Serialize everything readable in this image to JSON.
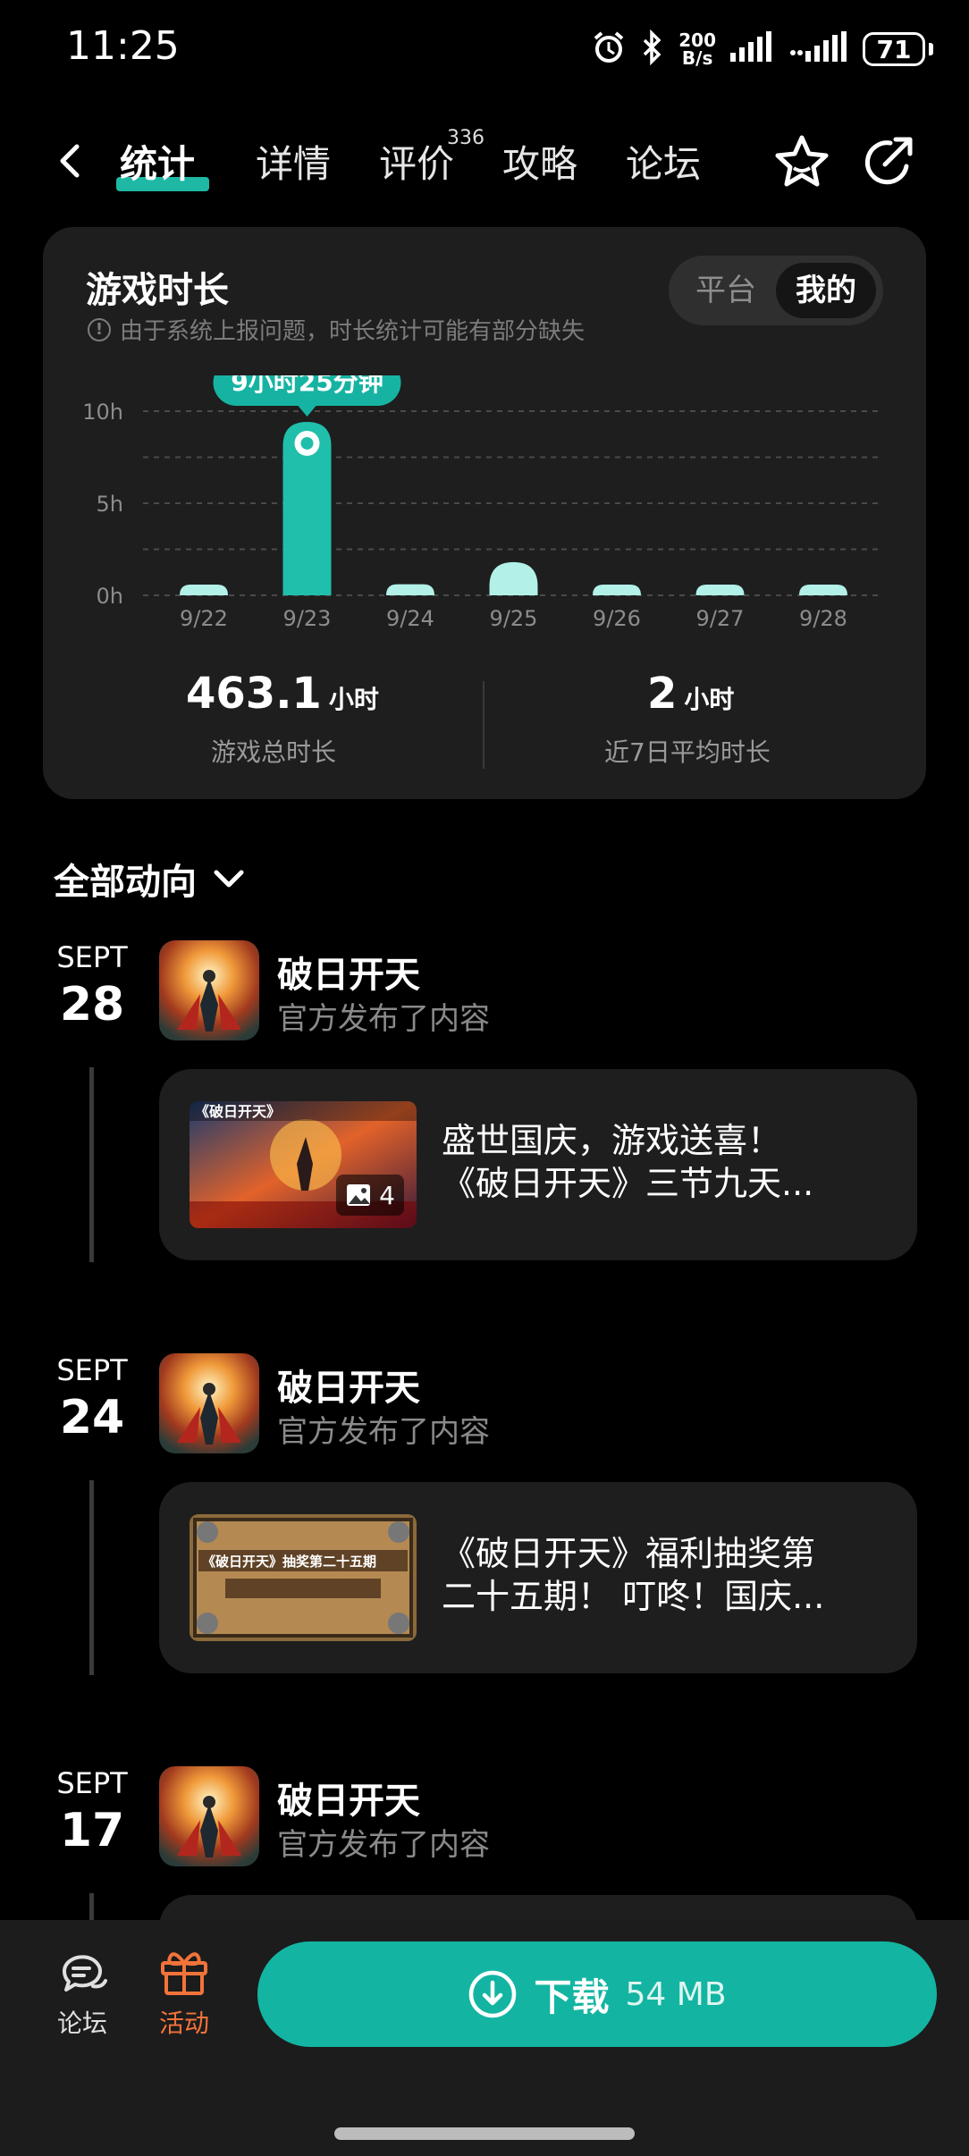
{
  "status": {
    "time": "11:25",
    "net_speed_value": "200",
    "net_speed_unit": "B/s",
    "battery": "71"
  },
  "nav": {
    "tabs": [
      {
        "label": "统计"
      },
      {
        "label": "详情"
      },
      {
        "label": "评价"
      },
      {
        "label": "攻略"
      },
      {
        "label": "论坛"
      }
    ],
    "review_count": "336"
  },
  "stats": {
    "title": "游戏时长",
    "note": "由于系统上报问题，时长统计可能有部分缺失",
    "toggle": {
      "platform": "平台",
      "mine": "我的"
    },
    "total_value": "463.1",
    "total_unit": "小时",
    "total_label": "游戏总时长",
    "avg_value": "2",
    "avg_unit": "小时",
    "avg_label": "近7日平均时长"
  },
  "chart_data": {
    "type": "bar",
    "categories": [
      "9/22",
      "9/23",
      "9/24",
      "9/25",
      "9/26",
      "9/27",
      "9/28"
    ],
    "values": [
      0.1,
      9.42,
      0.6,
      1.8,
      0.1,
      0.1,
      0.1
    ],
    "y_ticks": [
      "0h",
      "5h",
      "10h"
    ],
    "ylim": [
      0,
      10
    ],
    "highlight_index": 1,
    "highlight_label": "9小时25分钟",
    "grid": true,
    "colors": {
      "highlight": "#1fbfac",
      "bar": "#b2f0e8",
      "tooltip": "#17b3a2"
    }
  },
  "feed": {
    "section_title": "全部动向",
    "items": [
      {
        "month": "SEPT",
        "day": "28",
        "game": "破日开天",
        "action": "官方发布了内容",
        "post_line1": "盛世国庆，游戏送喜！",
        "post_line2": "《破日开天》三节九天...",
        "image_count": "4",
        "thumb_caption": "《破日开天》"
      },
      {
        "month": "SEPT",
        "day": "24",
        "game": "破日开天",
        "action": "官方发布了内容",
        "post_line1": "《破日开天》福利抽奖第",
        "post_line2": "二十五期！ 叮咚！国庆...",
        "thumb_caption": "《破日开天》抽奖第二十五期"
      },
      {
        "month": "SEPT",
        "day": "17",
        "game": "破日开天",
        "action": "官方发布了内容"
      }
    ]
  },
  "bottom": {
    "forum_label": "论坛",
    "activity_label": "活动",
    "download_label": "下载",
    "download_size": "54 MB"
  }
}
